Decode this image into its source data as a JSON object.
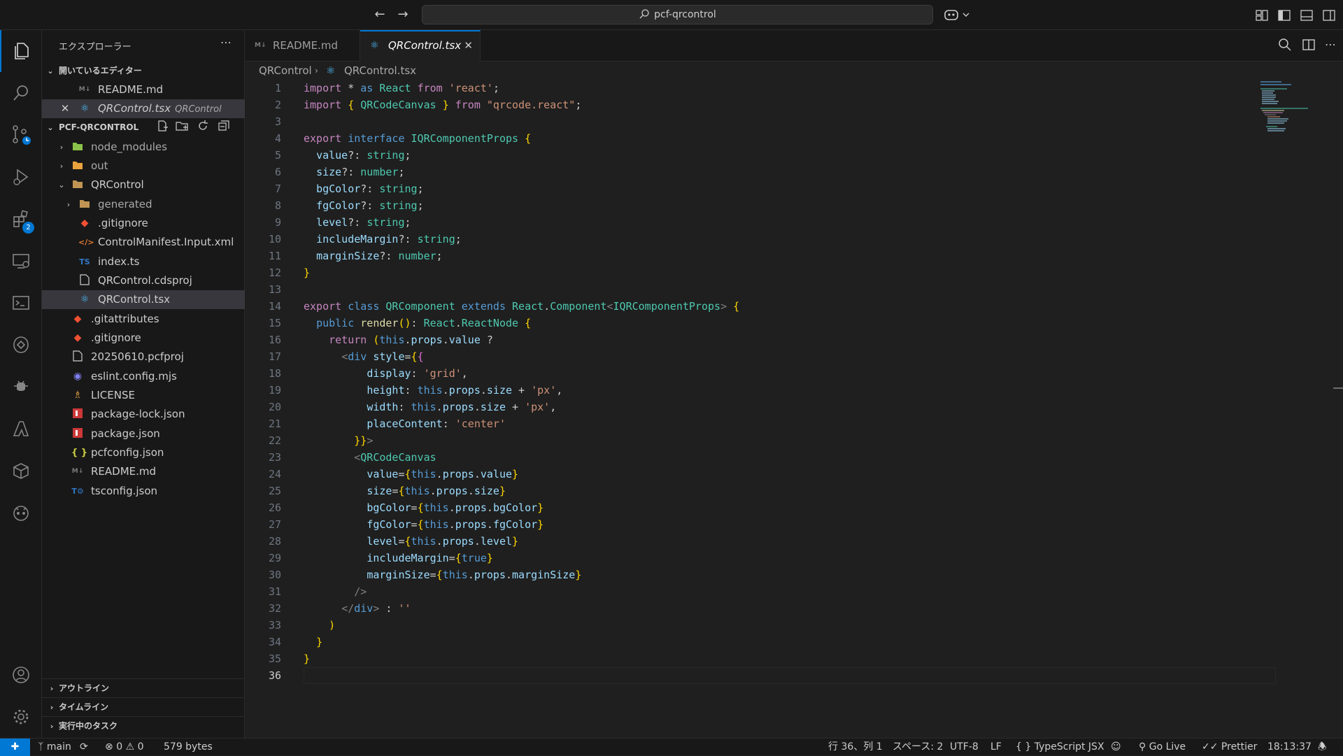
{
  "titlebar": {
    "search_text": "pcf-qrcontrol"
  },
  "activity": {
    "extensions_badge": "2"
  },
  "explorer": {
    "title": "エクスプローラー",
    "open_editors_header": "開いているエディター",
    "open_editors": [
      {
        "name": "README.md"
      },
      {
        "name": "QRControl.tsx",
        "desc": "QRControl"
      }
    ],
    "project_header": "PCF-QRCONTROL",
    "tree": [
      {
        "name": "node_modules"
      },
      {
        "name": "out"
      },
      {
        "name": "QRControl"
      },
      {
        "name": "generated"
      },
      {
        "name": ".gitignore"
      },
      {
        "name": "ControlManifest.Input.xml"
      },
      {
        "name": "index.ts"
      },
      {
        "name": "QRControl.cdsproj"
      },
      {
        "name": "QRControl.tsx"
      },
      {
        "name": ".gitattributes"
      },
      {
        "name": ".gitignore"
      },
      {
        "name": "20250610.pcfproj"
      },
      {
        "name": "eslint.config.mjs"
      },
      {
        "name": "LICENSE"
      },
      {
        "name": "package-lock.json"
      },
      {
        "name": "package.json"
      },
      {
        "name": "pcfconfig.json"
      },
      {
        "name": "README.md"
      },
      {
        "name": "tsconfig.json"
      }
    ],
    "outline_header": "アウトライン",
    "timeline_header": "タイムライン",
    "tasks_header": "実行中のタスク"
  },
  "tabs": [
    {
      "label": "README.md"
    },
    {
      "label": "QRControl.tsx"
    }
  ],
  "breadcrumb": {
    "folder": "QRControl",
    "file": "QRControl.tsx"
  },
  "editor": {
    "line_numbers": [
      "1",
      "2",
      "3",
      "4",
      "5",
      "6",
      "7",
      "8",
      "9",
      "10",
      "11",
      "12",
      "13",
      "14",
      "15",
      "16",
      "17",
      "18",
      "19",
      "20",
      "21",
      "22",
      "23",
      "24",
      "25",
      "26",
      "27",
      "28",
      "29",
      "30",
      "31",
      "32",
      "33",
      "34",
      "35",
      "36"
    ],
    "lines": [
      "import * as React from 'react';",
      "import { QRCodeCanvas } from \"qrcode.react\";",
      "",
      "export interface IQRComponentProps {",
      "  value?: string;",
      "  size?: number;",
      "  bgColor?: string;",
      "  fgColor?: string;",
      "  level?: string;",
      "  includeMargin?: string;",
      "  marginSize?: number;",
      "}",
      "",
      "export class QRComponent extends React.Component<IQRComponentProps> {",
      "  public render(): React.ReactNode {",
      "    return (this.props.value ?",
      "      <div style={{",
      "          display: 'grid',",
      "          height: this.props.size + 'px',",
      "          width: this.props.size + 'px',",
      "          placeContent: 'center'",
      "        }}>",
      "        <QRCodeCanvas",
      "          value={this.props.value}",
      "          size={this.props.size}",
      "          bgColor={this.props.bgColor}",
      "          fgColor={this.props.fgColor}",
      "          level={this.props.level}",
      "          includeMargin={true}",
      "          marginSize={this.props.marginSize}",
      "        />",
      "      </div> : ''",
      "    )",
      "  }",
      "}",
      ""
    ]
  },
  "status": {
    "branch": "main",
    "errors": "0",
    "warnings": "0",
    "size": "579 bytes",
    "position": "行 36、列 1",
    "spaces": "スペース: 2",
    "encoding": "UTF-8",
    "eol": "LF",
    "language": "TypeScript JSX",
    "golive": "Go Live",
    "prettier": "Prettier",
    "time": "18:13:37"
  },
  "colors": {
    "accent": "#0078d4",
    "background": "#1f1f1f",
    "sidebar": "#181818"
  }
}
